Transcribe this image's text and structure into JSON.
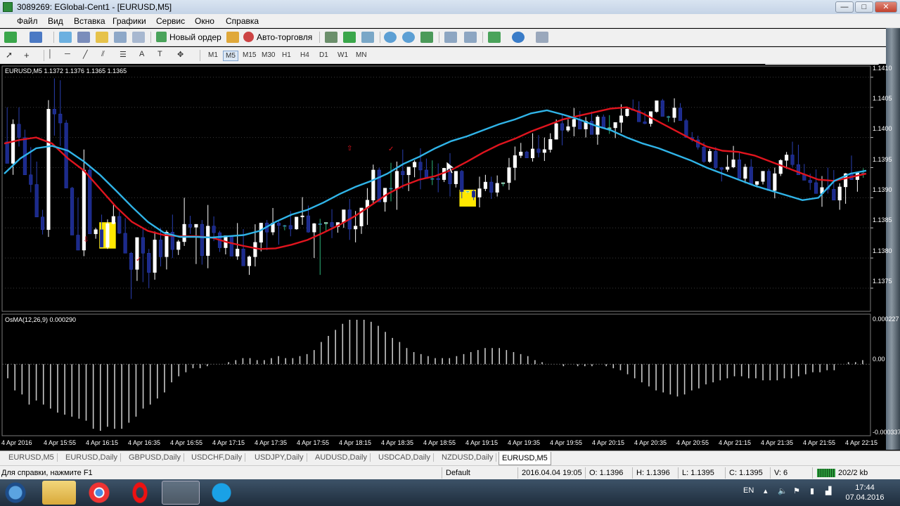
{
  "window": {
    "title": "3089269: EGlobal-Cent1 - [EURUSD,M5]",
    "minimize": "—",
    "maximize": "□",
    "close": "✕"
  },
  "menu": [
    "Файл",
    "Вид",
    "Вставка",
    "Графики",
    "Сервис",
    "Окно",
    "Справка"
  ],
  "toolbar": {
    "new_order": "Новый ордер",
    "auto_trading": "Авто-торговля"
  },
  "timeframes": [
    "M1",
    "M5",
    "M15",
    "M30",
    "H1",
    "H4",
    "D1",
    "W1",
    "MN"
  ],
  "active_timeframe": "M5",
  "chart": {
    "symbol_info": "EURUSD,M5  1.1372 1.1376 1.1365 1.1365",
    "indicator_label": "OsMA(12,26,9) 0.000290",
    "price_labels": [
      "1.1410",
      "1.1405",
      "1.1400",
      "1.1395",
      "1.1390",
      "1.1385",
      "1.1380",
      "1.1375"
    ],
    "osma_labels": [
      "0.000227",
      "0.00",
      "-0.000337"
    ],
    "time_labels": [
      "4 Apr 2016",
      "4 Apr 15:55",
      "4 Apr 16:15",
      "4 Apr 16:35",
      "4 Apr 16:55",
      "4 Apr 17:15",
      "4 Apr 17:35",
      "4 Apr 17:55",
      "4 Apr 18:15",
      "4 Apr 18:35",
      "4 Apr 18:55",
      "4 Apr 19:15",
      "4 Apr 19:35",
      "4 Apr 19:55",
      "4 Apr 20:15",
      "4 Apr 20:35",
      "4 Apr 20:55",
      "4 Apr 21:15",
      "4 Apr 21:35",
      "4 Apr 21:55",
      "4 Apr 22:15"
    ],
    "colors": {
      "bull": "#ffffff",
      "bear": "#1c2a8c",
      "doji": "#2db57a",
      "fast_ma": "#e0141e",
      "slow_ma": "#30b4e8",
      "highlight": "#ffe800",
      "osma": "#c8c8c8"
    }
  },
  "chart_data": {
    "type": "candlestick",
    "symbol": "EURUSD",
    "timeframe": "M5",
    "ylim": [
      1.13715,
      1.14115
    ],
    "candles_ohlc": [
      [
        1.13993,
        1.1405,
        1.13957,
        1.13957
      ],
      [
        1.13957,
        1.1403,
        1.13938,
        1.14022
      ],
      [
        1.14022,
        1.1405,
        1.13985,
        1.14
      ],
      [
        1.14,
        1.14013,
        1.13938,
        1.13938
      ],
      [
        1.13938,
        1.13984,
        1.13909,
        1.13922
      ],
      [
        1.13922,
        1.1396,
        1.13868,
        1.13868
      ],
      [
        1.13868,
        1.1388,
        1.13839,
        1.13847
      ],
      [
        1.13847,
        1.14062,
        1.13835,
        1.14047
      ],
      [
        1.14047,
        1.14098,
        1.14003,
        1.14039
      ],
      [
        1.14039,
        1.14095,
        1.13986,
        1.14024
      ],
      [
        1.14024,
        1.14029,
        1.13916,
        1.13916
      ],
      [
        1.13916,
        1.13918,
        1.13838,
        1.13838
      ],
      [
        1.13838,
        1.139,
        1.13813,
        1.13813
      ],
      [
        1.13813,
        1.1398,
        1.13803,
        1.13946
      ],
      [
        1.13946,
        1.13954,
        1.1384,
        1.1384
      ],
      [
        1.1384,
        1.1385,
        1.13832,
        1.13847
      ],
      [
        1.13847,
        1.13872,
        1.13818,
        1.13818
      ],
      [
        1.13818,
        1.13864,
        1.13815,
        1.13857
      ],
      [
        1.13857,
        1.13888,
        1.13856,
        1.13869
      ],
      [
        1.13869,
        1.13877,
        1.1384,
        1.13841
      ],
      [
        1.13841,
        1.13866,
        1.13808,
        1.13808
      ],
      [
        1.13808,
        1.1381,
        1.13732,
        1.13781
      ],
      [
        1.13781,
        1.13834,
        1.13762,
        1.13834
      ],
      [
        1.13834,
        1.13849,
        1.1376,
        1.13808
      ],
      [
        1.13808,
        1.13815,
        1.1375,
        1.13776
      ],
      [
        1.13776,
        1.13844,
        1.13764,
        1.1383
      ],
      [
        1.1383,
        1.1385,
        1.13786,
        1.13802
      ],
      [
        1.13802,
        1.13846,
        1.13781,
        1.13843
      ],
      [
        1.13843,
        1.13872,
        1.138,
        1.13814
      ],
      [
        1.13814,
        1.1383,
        1.13805,
        1.13827
      ],
      [
        1.13827,
        1.139,
        1.1382,
        1.13856
      ],
      [
        1.13856,
        1.1387,
        1.1384,
        1.13851
      ],
      [
        1.13851,
        1.13856,
        1.1379,
        1.13856
      ],
      [
        1.13856,
        1.13863,
        1.13789,
        1.13804
      ],
      [
        1.13804,
        1.13888,
        1.13783,
        1.13853
      ],
      [
        1.13853,
        1.13869,
        1.13828,
        1.13842
      ],
      [
        1.13842,
        1.13845,
        1.1381,
        1.13817
      ],
      [
        1.13817,
        1.13837,
        1.13806,
        1.13837
      ],
      [
        1.13837,
        1.13837,
        1.13803,
        1.13803
      ],
      [
        1.13803,
        1.13858,
        1.13797,
        1.13815
      ],
      [
        1.13815,
        1.13848,
        1.13787,
        1.13787
      ],
      [
        1.13787,
        1.13804,
        1.13772,
        1.13802
      ],
      [
        1.13802,
        1.13856,
        1.13786,
        1.13826
      ],
      [
        1.13826,
        1.13858,
        1.13811,
        1.13858
      ],
      [
        1.13858,
        1.13863,
        1.13813,
        1.13843
      ],
      [
        1.13843,
        1.13883,
        1.13838,
        1.13858
      ],
      [
        1.13858,
        1.13861,
        1.13822,
        1.13854
      ],
      [
        1.13854,
        1.13855,
        1.13846,
        1.13854
      ],
      [
        1.13854,
        1.13878,
        1.13836,
        1.13848
      ],
      [
        1.13848,
        1.13868,
        1.13847,
        1.13868
      ],
      [
        1.13868,
        1.13901,
        1.13855,
        1.1387
      ],
      [
        1.1387,
        1.13887,
        1.13842,
        1.13843
      ],
      [
        1.13843,
        1.13858,
        1.138,
        1.13857
      ],
      [
        1.13857,
        1.13865,
        1.13772,
        1.13857
      ],
      [
        1.13857,
        1.13859,
        1.13844,
        1.13859
      ],
      [
        1.13859,
        1.13881,
        1.13833,
        1.13852
      ],
      [
        1.13852,
        1.13859,
        1.13842,
        1.13859
      ],
      [
        1.13859,
        1.1388,
        1.1385,
        1.1388
      ],
      [
        1.1388,
        1.13898,
        1.1383,
        1.13848
      ],
      [
        1.13848,
        1.13878,
        1.13826,
        1.13853
      ],
      [
        1.13853,
        1.13883,
        1.1384,
        1.13883
      ],
      [
        1.13883,
        1.13916,
        1.13855,
        1.13896
      ],
      [
        1.13896,
        1.13955,
        1.13891,
        1.13946
      ],
      [
        1.13946,
        1.1395,
        1.13893,
        1.13893
      ],
      [
        1.13893,
        1.13916,
        1.13877,
        1.13916
      ],
      [
        1.13916,
        1.13958,
        1.13894,
        1.13915
      ],
      [
        1.13915,
        1.1396,
        1.1388,
        1.13944
      ],
      [
        1.13944,
        1.1398,
        1.13915,
        1.13938
      ],
      [
        1.13938,
        1.13951,
        1.13911,
        1.13951
      ],
      [
        1.13951,
        1.13962,
        1.13934,
        1.13959
      ],
      [
        1.13959,
        1.13982,
        1.13914,
        1.13946
      ],
      [
        1.13946,
        1.13965,
        1.13932,
        1.13932
      ],
      [
        1.13932,
        1.13962,
        1.13921,
        1.13932
      ],
      [
        1.13932,
        1.13957,
        1.13909,
        1.1393
      ],
      [
        1.1393,
        1.13949,
        1.13926,
        1.13949
      ],
      [
        1.13949,
        1.13974,
        1.13902,
        1.13923
      ],
      [
        1.13923,
        1.13944,
        1.13917,
        1.13944
      ],
      [
        1.13944,
        1.13946,
        1.13899,
        1.1391
      ],
      [
        1.1391,
        1.13911,
        1.13908,
        1.13911
      ],
      [
        1.13911,
        1.13914,
        1.13896,
        1.13901
      ],
      [
        1.13901,
        1.13935,
        1.13884,
        1.13915
      ],
      [
        1.13915,
        1.13938,
        1.13911,
        1.13926
      ],
      [
        1.13926,
        1.13935,
        1.13898,
        1.13909
      ],
      [
        1.13909,
        1.13937,
        1.13902,
        1.13924
      ],
      [
        1.13924,
        1.13925,
        1.13919,
        1.13925
      ],
      [
        1.13925,
        1.13966,
        1.13913,
        1.1395
      ],
      [
        1.1395,
        1.13985,
        1.13929,
        1.1397
      ],
      [
        1.1397,
        1.13991,
        1.13966,
        1.13976
      ],
      [
        1.13976,
        1.13978,
        1.13966,
        1.13966
      ],
      [
        1.13966,
        1.14007,
        1.1396,
        1.13981
      ],
      [
        1.13981,
        1.14004,
        1.13967,
        1.13975
      ],
      [
        1.13975,
        1.14,
        1.13961,
        1.1398
      ],
      [
        1.1398,
        1.14007,
        1.13975,
        1.13997
      ],
      [
        1.13997,
        1.1403,
        1.13997,
        1.14023
      ],
      [
        1.14023,
        1.14039,
        1.13987,
        1.14012
      ],
      [
        1.14012,
        1.1403,
        1.14009,
        1.14018
      ],
      [
        1.14018,
        1.14049,
        1.14002,
        1.1403
      ],
      [
        1.1403,
        1.14044,
        1.14014,
        1.14014
      ],
      [
        1.14014,
        1.14034,
        1.14,
        1.14027
      ],
      [
        1.14027,
        1.14043,
        1.14005,
        1.14005
      ],
      [
        1.14005,
        1.14037,
        1.13988,
        1.14034
      ],
      [
        1.14034,
        1.14038,
        1.14015,
        1.14015
      ],
      [
        1.14015,
        1.14037,
        1.14006,
        1.14016
      ],
      [
        1.14016,
        1.14025,
        1.13999,
        1.14025
      ],
      [
        1.14025,
        1.14055,
        1.14008,
        1.14036
      ],
      [
        1.14036,
        1.14051,
        1.14034,
        1.14047
      ],
      [
        1.14047,
        1.14063,
        1.14045,
        1.14045
      ],
      [
        1.14045,
        1.1406,
        1.14026,
        1.14026
      ],
      [
        1.14026,
        1.14043,
        1.14022,
        1.14023
      ],
      [
        1.14023,
        1.14043,
        1.14018,
        1.14043
      ],
      [
        1.14043,
        1.14061,
        1.14041,
        1.14061
      ],
      [
        1.14061,
        1.14064,
        1.14035,
        1.14035
      ],
      [
        1.14035,
        1.14036,
        1.14026,
        1.14033
      ],
      [
        1.14033,
        1.14065,
        1.14025,
        1.14049
      ],
      [
        1.14049,
        1.14057,
        1.14028,
        1.14028
      ],
      [
        1.14028,
        1.14031,
        1.14,
        1.14
      ],
      [
        1.14,
        1.14009,
        1.13993,
        1.13996
      ],
      [
        1.13996,
        1.14003,
        1.1398,
        1.13984
      ],
      [
        1.13984,
        1.13992,
        1.13958,
        1.1396
      ],
      [
        1.1396,
        1.13981,
        1.13958,
        1.13977
      ],
      [
        1.13977,
        1.13984,
        1.13947,
        1.1395
      ],
      [
        1.1395,
        1.13951,
        1.13927,
        1.13947
      ],
      [
        1.13947,
        1.13971,
        1.13943,
        1.13951
      ],
      [
        1.13951,
        1.13986,
        1.13949,
        1.13963
      ],
      [
        1.13963,
        1.13976,
        1.13932,
        1.13932
      ],
      [
        1.13932,
        1.13956,
        1.13924,
        1.13951
      ],
      [
        1.13951,
        1.13964,
        1.13922,
        1.13922
      ],
      [
        1.13922,
        1.13927,
        1.13917,
        1.13927
      ],
      [
        1.13927,
        1.13944,
        1.13922,
        1.13944
      ],
      [
        1.13944,
        1.13948,
        1.13912,
        1.13912
      ],
      [
        1.13912,
        1.1395,
        1.13899,
        1.1394
      ],
      [
        1.1394,
        1.13964,
        1.13936,
        1.13962
      ],
      [
        1.13962,
        1.13976,
        1.13948,
        1.13971
      ],
      [
        1.13971,
        1.13993,
        1.13951,
        1.13955
      ],
      [
        1.13955,
        1.13988,
        1.13938,
        1.13938
      ],
      [
        1.13938,
        1.13956,
        1.13929,
        1.13929
      ],
      [
        1.13929,
        1.1394,
        1.13913,
        1.13925
      ],
      [
        1.13925,
        1.13947,
        1.13907,
        1.13907
      ],
      [
        1.13907,
        1.13936,
        1.13885,
        1.13917
      ],
      [
        1.13917,
        1.1395,
        1.13907,
        1.13914
      ],
      [
        1.13914,
        1.13946,
        1.13896,
        1.13896
      ],
      [
        1.13896,
        1.13924,
        1.1388,
        1.13918
      ],
      [
        1.13918,
        1.13941,
        1.1389,
        1.1394
      ],
      [
        1.1394,
        1.1397,
        1.1393,
        1.1393
      ],
      [
        1.1393,
        1.13941,
        1.1391,
        1.13941
      ],
      [
        1.13941,
        1.13949,
        1.13933,
        1.13941
      ]
    ],
    "osma": [
      -7e-05,
      -0.00013,
      -0.00015,
      -0.0002,
      -0.00018,
      -0.0002,
      -0.00022,
      -0.00024,
      -0.00025,
      -0.00026,
      -0.00027,
      -0.00028,
      -0.00032,
      -0.00033,
      -0.00031,
      -0.00032,
      -0.00032,
      -0.00029,
      -0.00026,
      -0.00022,
      -0.0002,
      -0.00017,
      -0.00014,
      -9e-05,
      -6e-05,
      -4e-05,
      -2e-05,
      -2e-05,
      -1e-05,
      0.0,
      0.0,
      1e-05,
      2e-05,
      3e-05,
      3e-05,
      2e-05,
      2e-05,
      3e-05,
      4e-05,
      3e-05,
      3e-05,
      4e-05,
      5e-05,
      7e-05,
      0.00011,
      0.00014,
      0.00017,
      0.0002,
      0.00022,
      0.00022,
      0.00022,
      0.00021,
      0.00019,
      0.00016,
      0.00013,
      0.00011,
      8e-05,
      6e-05,
      5e-05,
      4e-05,
      3e-05,
      3e-05,
      3e-05,
      4e-05,
      5e-05,
      6e-05,
      7e-05,
      8e-05,
      8e-05,
      8e-05,
      7e-05,
      6e-05,
      5e-05,
      4e-05,
      2e-05,
      1e-05,
      0.0,
      0.0,
      -1e-05,
      0.0,
      -1e-05,
      -1e-05,
      -1e-05,
      0.0,
      -1e-05,
      -2e-05,
      -3e-05,
      -5e-05,
      -7e-05,
      -9e-05,
      -0.00011,
      -0.00013,
      -0.00014,
      -0.00015,
      -0.00016,
      -0.00015,
      -0.00013,
      -0.00012,
      -0.0001,
      -9e-05,
      -8e-05,
      -7e-05,
      -6e-05,
      -6e-05,
      -7e-05,
      -7e-05,
      -8e-05,
      -8e-05,
      -8e-05,
      -7e-05,
      -7e-05,
      -6e-05,
      -5e-05,
      -4e-05,
      -4e-05,
      -3e-05,
      -3e-05,
      0.0,
      1e-05,
      1e-05,
      2e-05
    ],
    "osma_ylim": [
      -0.000337,
      0.000227
    ],
    "moving_averages": [
      {
        "name": "fast",
        "values": [
          1.1399,
          1.13996,
          1.14,
          1.1399,
          1.13965,
          1.13945,
          1.13915,
          1.13885,
          1.1386,
          1.13845,
          1.13838,
          1.13836,
          1.13836,
          1.13834,
          1.13826,
          1.1382,
          1.13815,
          1.13816,
          1.13822,
          1.1383,
          1.13842,
          1.13855,
          1.1387,
          1.13888,
          1.13906,
          1.1392,
          1.1393,
          1.13936,
          1.13946,
          1.1396,
          1.13975,
          1.13988,
          1.13998,
          1.1401,
          1.1402,
          1.1403,
          1.14036,
          1.14042,
          1.14048,
          1.1405,
          1.1404,
          1.14026,
          1.14012,
          1.13998,
          1.13985,
          1.13978,
          1.13976,
          1.1397,
          1.1396,
          1.1395,
          1.1394,
          1.1393,
          1.13928,
          1.13934,
          1.1394
        ]
      },
      {
        "name": "slow",
        "values": [
          1.1394,
          1.13965,
          1.13982,
          1.13986,
          1.13978,
          1.1396,
          1.13938,
          1.13912,
          1.13885,
          1.1386,
          1.13842,
          1.13835,
          1.13835,
          1.13834,
          1.13836,
          1.13838,
          1.13845,
          1.1386,
          1.13872,
          1.1388,
          1.13892,
          1.13906,
          1.13918,
          1.13928,
          1.1394,
          1.13956,
          1.13968,
          1.13982,
          1.13994,
          1.14002,
          1.14012,
          1.14022,
          1.1403,
          1.1404,
          1.14045,
          1.14038,
          1.1403,
          1.1402,
          1.14012,
          1.14,
          1.1399,
          1.13982,
          1.13972,
          1.13962,
          1.1395,
          1.1394,
          1.1393,
          1.1392,
          1.13912,
          1.13904,
          1.13896,
          1.139,
          1.13928,
          1.1394,
          1.13945
        ]
      }
    ]
  },
  "tabs": [
    "EURUSD,M5",
    "EURUSD,Daily",
    "GBPUSD,Daily",
    "USDCHF,Daily",
    "USDJPY,Daily",
    "AUDUSD,Daily",
    "USDCAD,Daily",
    "NZDUSD,Daily",
    "EURUSD,M5"
  ],
  "status": {
    "help": "Для справки, нажмите F1",
    "profile": "Default",
    "datetime": "2016.04.04 19:05",
    "open": "O: 1.1396",
    "high": "H: 1.1396",
    "low": "L: 1.1395",
    "close": "C: 1.1395",
    "volume": "V: 6",
    "traffic": "202/2 kb"
  },
  "taskbar": {
    "lang": "EN",
    "time": "17:44",
    "date": "07.04.2016"
  }
}
